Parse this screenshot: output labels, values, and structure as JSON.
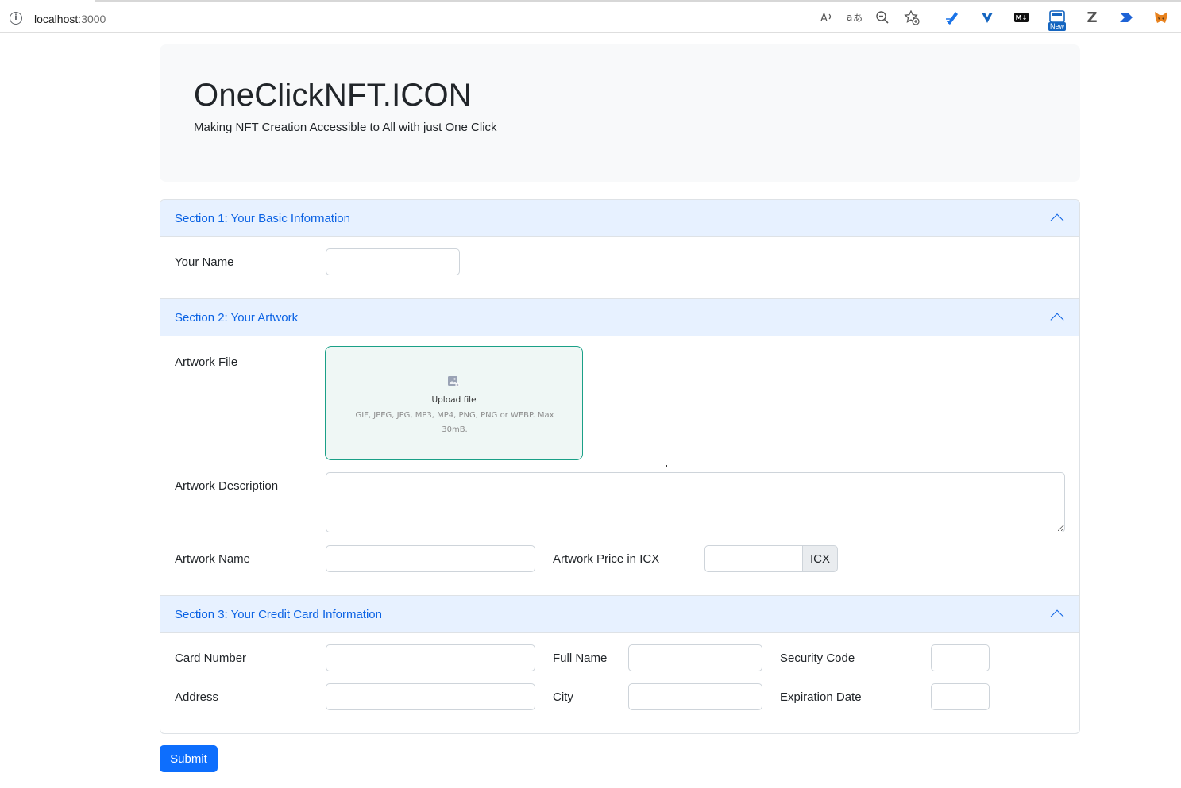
{
  "browser": {
    "url_host": "localhost",
    "url_port": ":3000",
    "new_badge": "New",
    "toolbar_icons": [
      "read-aloud-icon",
      "translate-icon",
      "zoom-out-icon",
      "add-favorite-icon",
      "ext-pen-icon",
      "ext-v-icon",
      "ext-markdown-icon",
      "ext-new-icon",
      "ext-z-icon",
      "ext-arrow-icon",
      "ext-metamask-icon"
    ],
    "md_label": "M↓",
    "z_label": "Z"
  },
  "header": {
    "title": "OneClickNFT.ICON",
    "subtitle": "Making NFT Creation Accessible to All with just One Click"
  },
  "section1": {
    "title": "Section 1: Your Basic Information",
    "name_label": "Your Name",
    "name_value": ""
  },
  "section2": {
    "title": "Section 2: Your Artwork",
    "file_label": "Artwork File",
    "upload_title": "Upload file",
    "upload_hint": "GIF, JPEG, JPG, MP3, MP4, PNG, PNG or WEBP. Max 30mB.",
    "description_label": "Artwork Description",
    "name_label": "Artwork Name",
    "price_label": "Artwork Price in ICX",
    "price_addon": "ICX"
  },
  "section3": {
    "title": "Section 3: Your Credit Card Information",
    "card_number_label": "Card Number",
    "full_name_label": "Full Name",
    "security_code_label": "Security Code",
    "address_label": "Address",
    "city_label": "City",
    "expiration_label": "Expiration Date"
  },
  "submit_label": "Submit",
  "colors": {
    "accent": "#0d6efd",
    "section_header_bg": "#e7f1ff",
    "section_header_text": "#0c63e4",
    "upload_border": "#1aa087",
    "upload_bg": "#eff7f5"
  }
}
